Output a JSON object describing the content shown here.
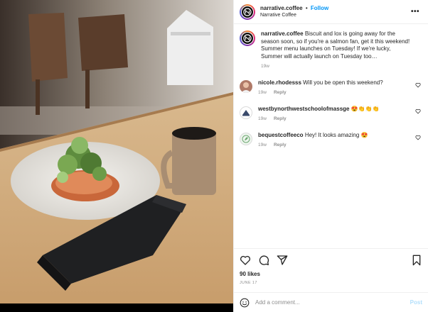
{
  "header": {
    "username": "narrative.coffee",
    "separator": "•",
    "follow_label": "Follow",
    "location": "Narrative Coffee",
    "more_label": "•••"
  },
  "caption": {
    "username": "narrative.coffee",
    "text": "Biscuit and lox is going away for the season soon, so if you're a salmon fan, get it this weekend! Summer menu launches on Tuesday! If we're lucky, Summer will actually launch on Tuesday too…",
    "time": "19w"
  },
  "comments": [
    {
      "username": "nicole.rhodesss",
      "text": "Will you be open this weekend?",
      "time": "19w",
      "reply_label": "Reply"
    },
    {
      "username": "westbynorthwestschoolofmassge",
      "text": "😍👏👏👏",
      "time": "19w",
      "reply_label": "Reply"
    },
    {
      "username": "bequestcoffeeco",
      "text": "Hey! It looks amazing 😍",
      "time": "19w",
      "reply_label": "Reply"
    }
  ],
  "likes": "90 likes",
  "date": "JUNE 17",
  "add_comment": {
    "placeholder": "Add a comment...",
    "post_label": "Post"
  },
  "icons": {
    "like": "heart-icon",
    "comment": "comment-icon",
    "share": "paper-plane-icon",
    "save": "bookmark-icon",
    "emoji": "emoji-icon"
  },
  "colors": {
    "accent": "#0095f6",
    "post_disabled": "#b2dffc",
    "muted": "#8e8e8e"
  }
}
